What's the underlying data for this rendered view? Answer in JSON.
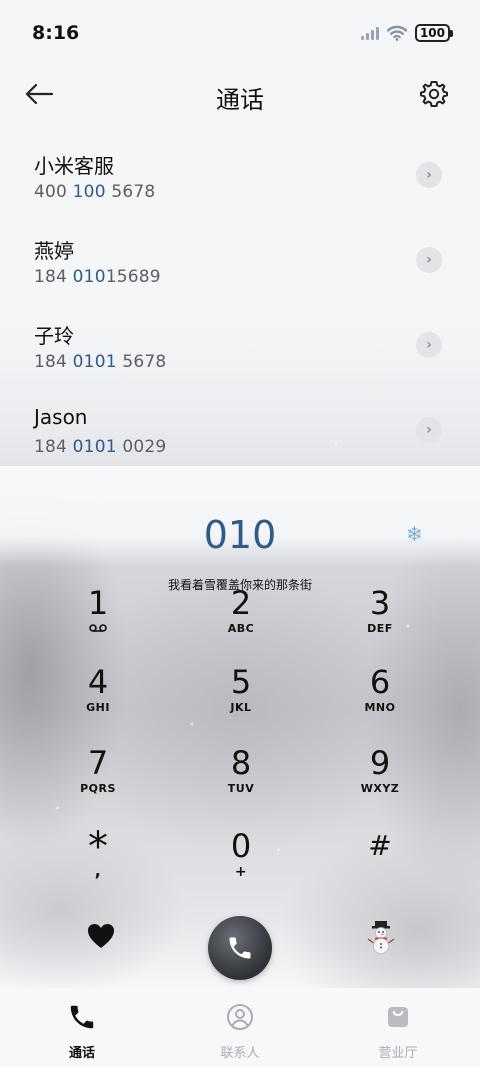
{
  "status": {
    "time": "8:16",
    "battery": "100"
  },
  "header": {
    "title": "通话"
  },
  "contacts": [
    {
      "name": "小米客服",
      "num_pre": "400 ",
      "num_hl": "100",
      "num_post": " 5678"
    },
    {
      "name": "燕婷",
      "num_pre": "184 ",
      "num_hl": "010",
      "num_post": "15689"
    },
    {
      "name": "子玲",
      "num_pre": "184 ",
      "num_hl": "0101",
      "num_post": " 5678"
    },
    {
      "name": "Jason",
      "num_pre": "184 ",
      "num_hl": "0101",
      "num_post": " 0029"
    }
  ],
  "dial": {
    "number": "010",
    "lyric": "我看着雪覆盖你来的那条街"
  },
  "keypad": [
    {
      "digit": "1",
      "letters": ""
    },
    {
      "digit": "2",
      "letters": "ABC"
    },
    {
      "digit": "3",
      "letters": "DEF"
    },
    {
      "digit": "4",
      "letters": "GHI"
    },
    {
      "digit": "5",
      "letters": "JKL"
    },
    {
      "digit": "6",
      "letters": "MNO"
    },
    {
      "digit": "7",
      "letters": "PQRS"
    },
    {
      "digit": "8",
      "letters": "TUV"
    },
    {
      "digit": "9",
      "letters": "WXYZ"
    },
    {
      "digit": "*",
      "letters": ","
    },
    {
      "digit": "0",
      "letters": "+"
    },
    {
      "digit": "#",
      "letters": ""
    }
  ],
  "nav": {
    "calls": "通话",
    "contacts": "联系人",
    "hall": "营业厅"
  },
  "colors": {
    "accent": "#2d5b8a",
    "nav_inactive": "#a9adb4"
  },
  "icons": {
    "key1_sub": "voicemail-icon",
    "left_action": "black-heart-icon",
    "right_action": "snowman-icon"
  }
}
